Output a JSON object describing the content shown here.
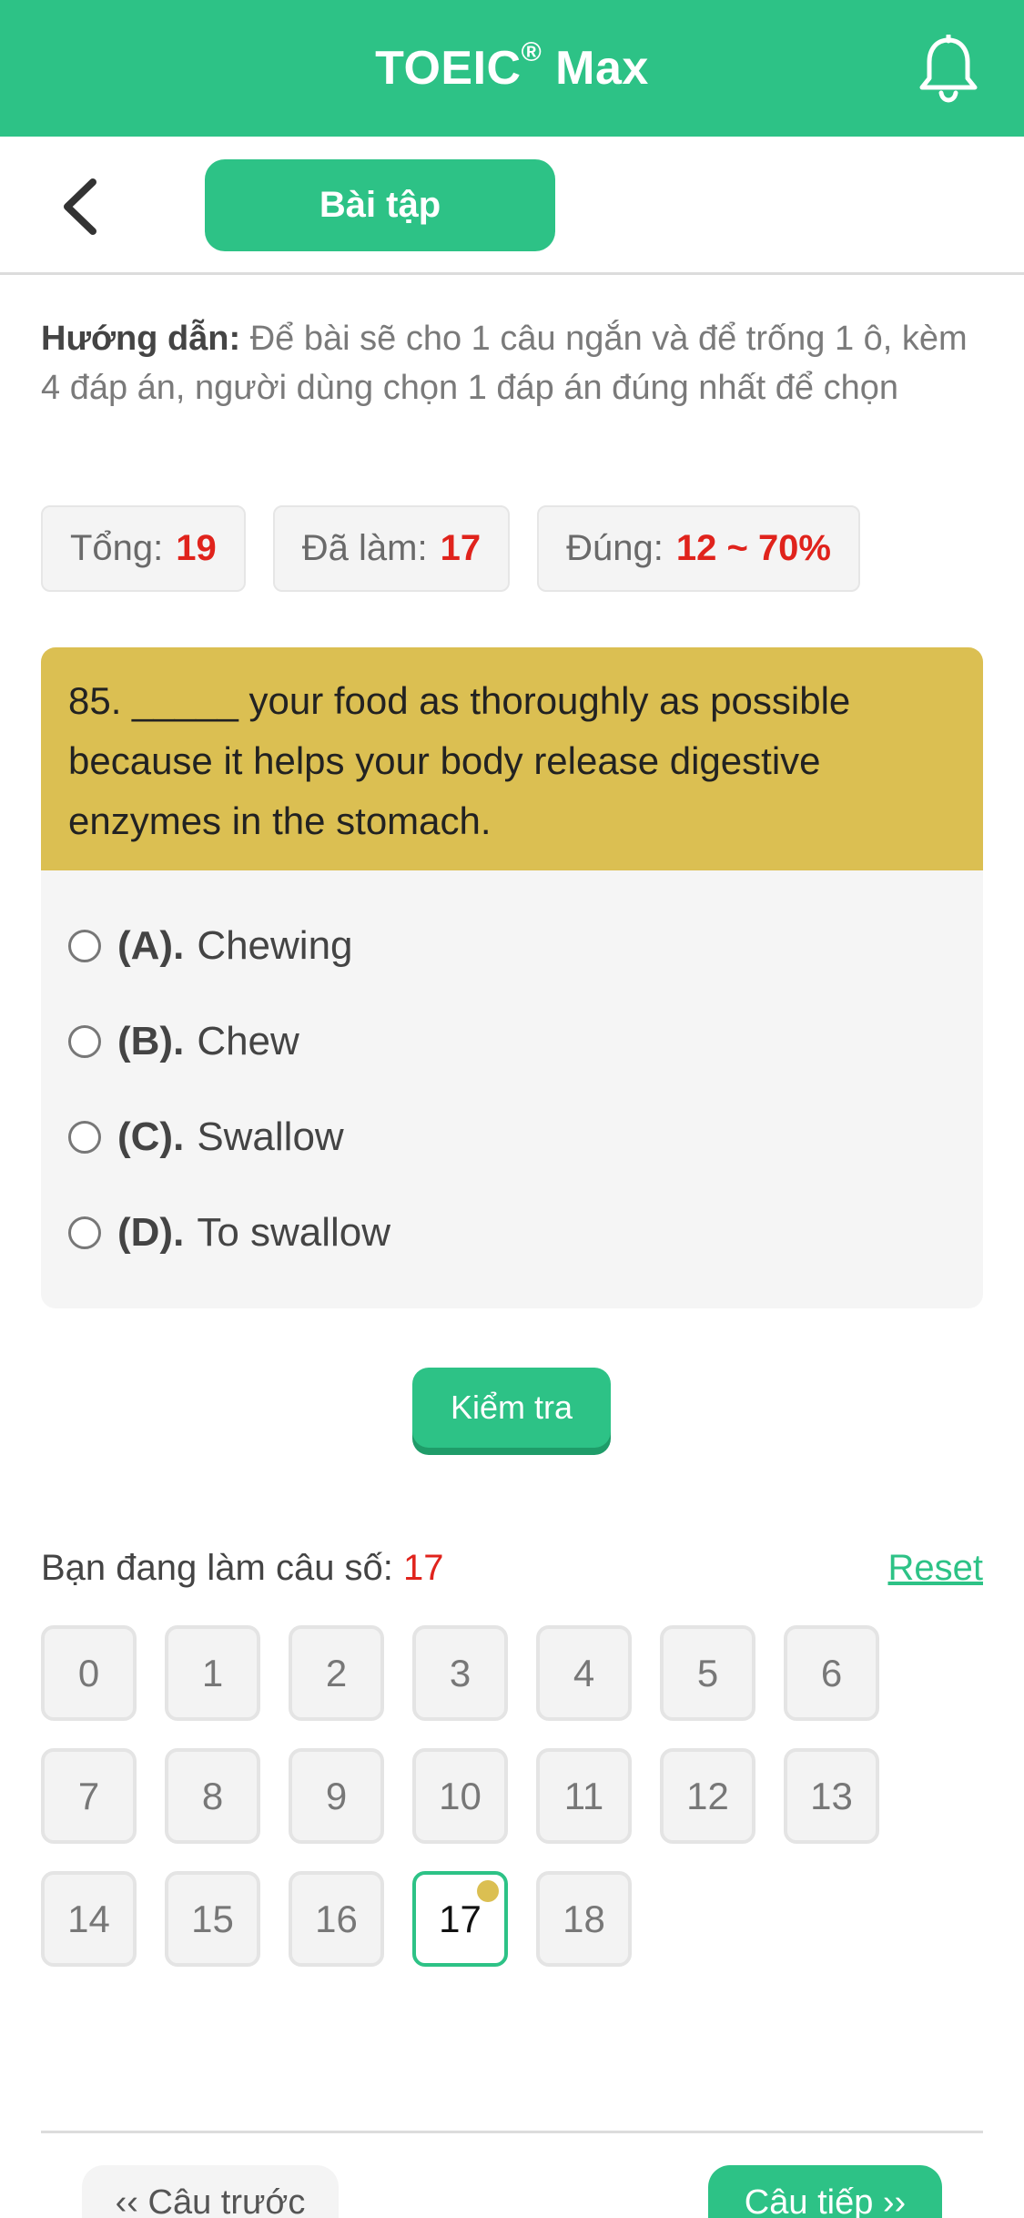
{
  "header": {
    "title": "TOEIC",
    "title_mark": "®",
    "title_suffix": " Max"
  },
  "subheader": {
    "tab_label": "Bài tập"
  },
  "instructions": {
    "label": "Hướng dẫn:",
    "text": " Để bài sẽ cho 1 câu ngắn và để trống 1 ô, kèm 4 đáp án, người dùng chọn 1 đáp án đúng nhất để chọn"
  },
  "stats": [
    {
      "label": "Tổng:",
      "value": "19"
    },
    {
      "label": "Đã làm:",
      "value": "17"
    },
    {
      "label": "Đúng:",
      "value": "12 ~ 70%"
    }
  ],
  "question": {
    "text": "85. _____ your food as thoroughly as possible because it helps your body release digestive enzymes in the stomach.",
    "options": [
      {
        "letter": "(A).",
        "text": "Chewing"
      },
      {
        "letter": "(B).",
        "text": "Chew"
      },
      {
        "letter": "(C).",
        "text": "Swallow"
      },
      {
        "letter": "(D).",
        "text": "To swallow"
      }
    ]
  },
  "check_button": "Kiểm tra",
  "progress": {
    "label": "Bạn đang làm câu số:",
    "current": "17",
    "reset": "Reset"
  },
  "grid": [
    "0",
    "1",
    "2",
    "3",
    "4",
    "5",
    "6",
    "7",
    "8",
    "9",
    "10",
    "11",
    "12",
    "13",
    "14",
    "15",
    "16",
    "17",
    "18"
  ],
  "grid_current_index": 17,
  "footer": {
    "prev": "‹‹ Câu trước",
    "next": "Câu tiếp ››"
  },
  "colors": {
    "brand": "#2dc286",
    "question_bg": "#dbbf52",
    "accent_red": "#e0231c"
  }
}
